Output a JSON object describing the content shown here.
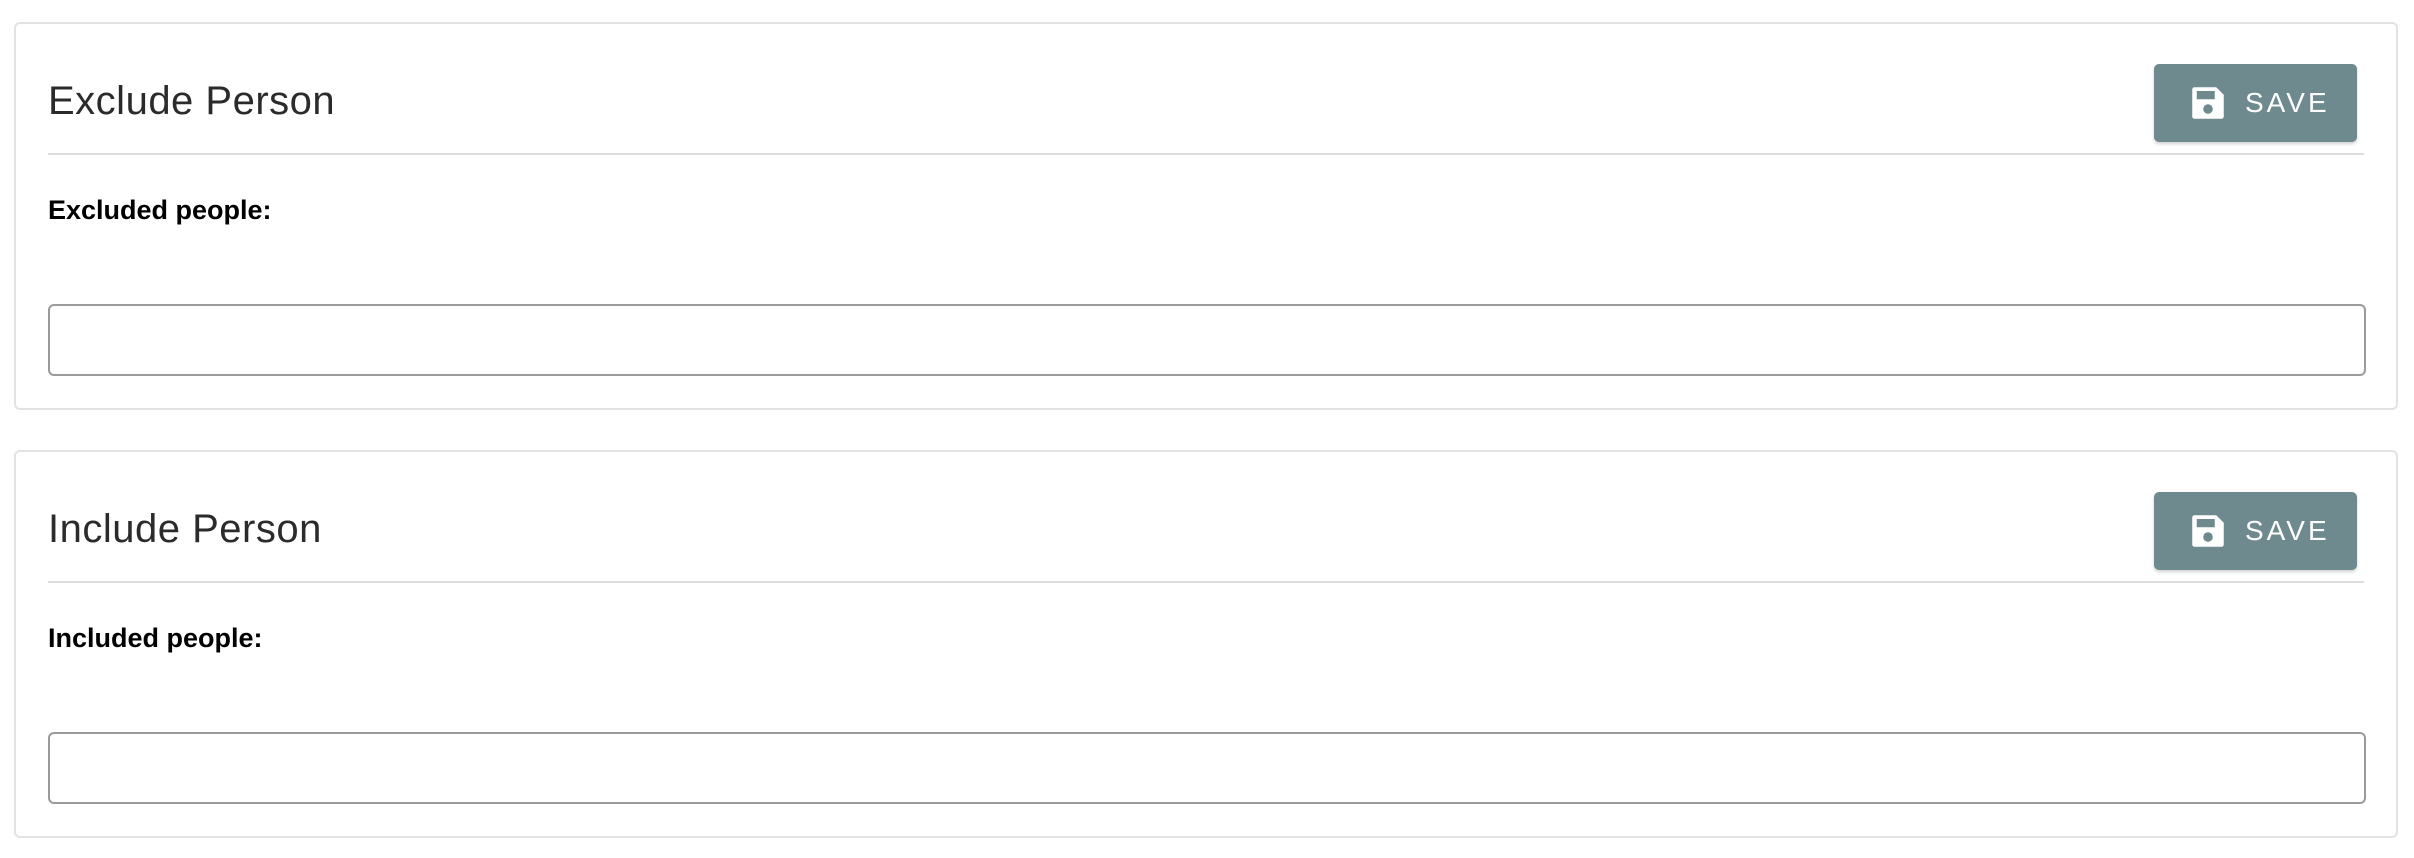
{
  "exclude_panel": {
    "title": "Exclude Person",
    "save_label": "SAVE",
    "save_icon": "floppy-disk-icon",
    "field_label": "Excluded people:",
    "field_value": ""
  },
  "include_panel": {
    "title": "Include Person",
    "save_label": "SAVE",
    "save_icon": "floppy-disk-icon",
    "field_label": "Included people:",
    "field_value": ""
  },
  "colors": {
    "button_bg": "#6e8a8e",
    "button_text": "#ffffff",
    "panel_border": "#e3e3e3",
    "title_text": "#2b2b2b"
  }
}
